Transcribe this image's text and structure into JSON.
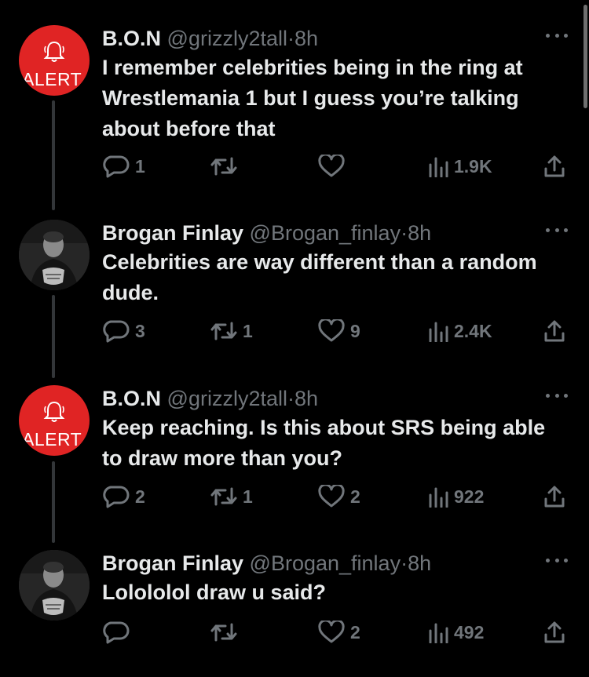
{
  "tweets": [
    {
      "avatar_type": "alert",
      "avatar_text": "ALERT",
      "name": "B.O.N",
      "handle": "@grizzly2tall",
      "separator": "·",
      "time": "8h",
      "text": "I remember celebrities being in the ring at Wrestlemania 1 but I guess you’re talking about before that",
      "replies": "1",
      "retweets": "",
      "likes": "",
      "views": "1.9K"
    },
    {
      "avatar_type": "photo",
      "name": "Brogan Finlay",
      "handle": "@Brogan_finlay",
      "separator": "·",
      "time": "8h",
      "text": "Celebrities are way different than a random dude.",
      "replies": "3",
      "retweets": "1",
      "likes": "9",
      "views": "2.4K"
    },
    {
      "avatar_type": "alert",
      "avatar_text": "ALERT",
      "name": "B.O.N",
      "handle": "@grizzly2tall",
      "separator": "·",
      "time": "8h",
      "text": "Keep reaching. Is this about SRS being able to draw more than you?",
      "replies": "2",
      "retweets": "1",
      "likes": "2",
      "views": "922"
    },
    {
      "avatar_type": "photo",
      "name": "Brogan Finlay",
      "handle": "@Brogan_finlay",
      "separator": "·",
      "time": "8h",
      "text": "Lolololol draw u said?",
      "replies": "",
      "retweets": "",
      "likes": "2",
      "views": "492"
    }
  ],
  "icons": {
    "reply": "reply-icon",
    "retweet": "retweet-icon",
    "like": "like-icon",
    "views": "views-icon",
    "share": "share-icon",
    "more": "more-icon",
    "bell": "bell-icon"
  },
  "colors": {
    "background": "#000000",
    "text": "#e7e9ea",
    "muted": "#71767b",
    "alert_red": "#e02424",
    "thread_line": "#333639"
  }
}
